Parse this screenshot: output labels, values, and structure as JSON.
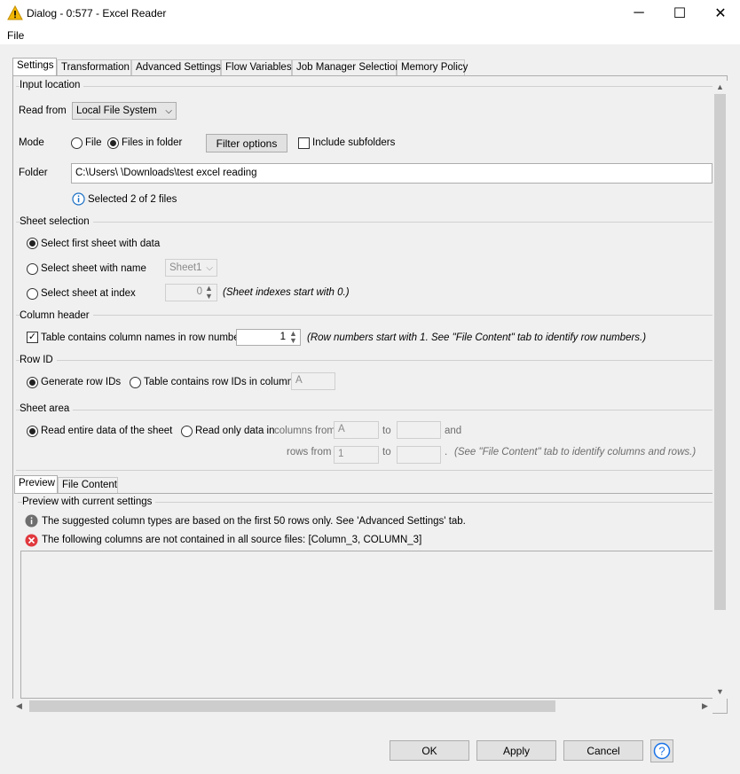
{
  "window": {
    "title": "Dialog - 0:577 - Excel Reader",
    "minimize": "─",
    "maximize": "☐",
    "close": "✕"
  },
  "menu": {
    "file": "File"
  },
  "tabs": [
    "Settings",
    "Transformation",
    "Advanced Settings",
    "Flow Variables",
    "Job Manager Selection",
    "Memory Policy"
  ],
  "input_location": {
    "title": "Input location",
    "read_from_label": "Read from",
    "read_from_value": "Local File System",
    "mode_label": "Mode",
    "mode_file": "File",
    "mode_files_in_folder": "Files in folder",
    "filter_options": "Filter options",
    "include_subfolders": "Include subfolders",
    "folder_label": "Folder",
    "folder_value": "C:\\Users\\          \\Downloads\\test excel reading",
    "selected_info": "Selected 2 of 2 files"
  },
  "sheet_selection": {
    "title": "Sheet selection",
    "first_sheet": "Select first sheet with data",
    "with_name": "Select sheet with name",
    "sheet_name": "Sheet1",
    "at_index": "Select sheet at index",
    "index_value": "0",
    "index_hint": "(Sheet indexes start with 0.)"
  },
  "column_header": {
    "title": "Column header",
    "contains_names": "Table contains column names in row number",
    "row_number": "1",
    "hint": "(Row numbers start with 1. See \"File Content\" tab to identify row numbers.)"
  },
  "row_id": {
    "title": "Row ID",
    "generate": "Generate row IDs",
    "contains_ids": "Table contains row IDs in column",
    "column_value": "A"
  },
  "sheet_area": {
    "title": "Sheet area",
    "entire": "Read entire data of the sheet",
    "read_only": "Read only data in",
    "columns_from": "columns from",
    "col_from_value": "A",
    "to": "to",
    "and": "and",
    "rows_from": "rows from",
    "row_from_value": "1",
    "dot": ".",
    "hint": "(See \"File Content\" tab to identify columns and rows.)"
  },
  "preview_tabs": [
    "Preview",
    "File Content"
  ],
  "preview": {
    "title": "Preview with current settings",
    "info_message": "The suggested column types are based on the first 50 rows only. See 'Advanced Settings' tab.",
    "error_message": "The following columns are not contained in all source files: [Column_3, COLUMN_3]"
  },
  "buttons": {
    "ok": "OK",
    "apply": "Apply",
    "cancel": "Cancel",
    "help": "?"
  },
  "colors": {
    "info_icon": "#6e6e6e",
    "error_icon": "#e0393e",
    "warning_icon": "#f2b705",
    "help_blue": "#1a73e8"
  }
}
